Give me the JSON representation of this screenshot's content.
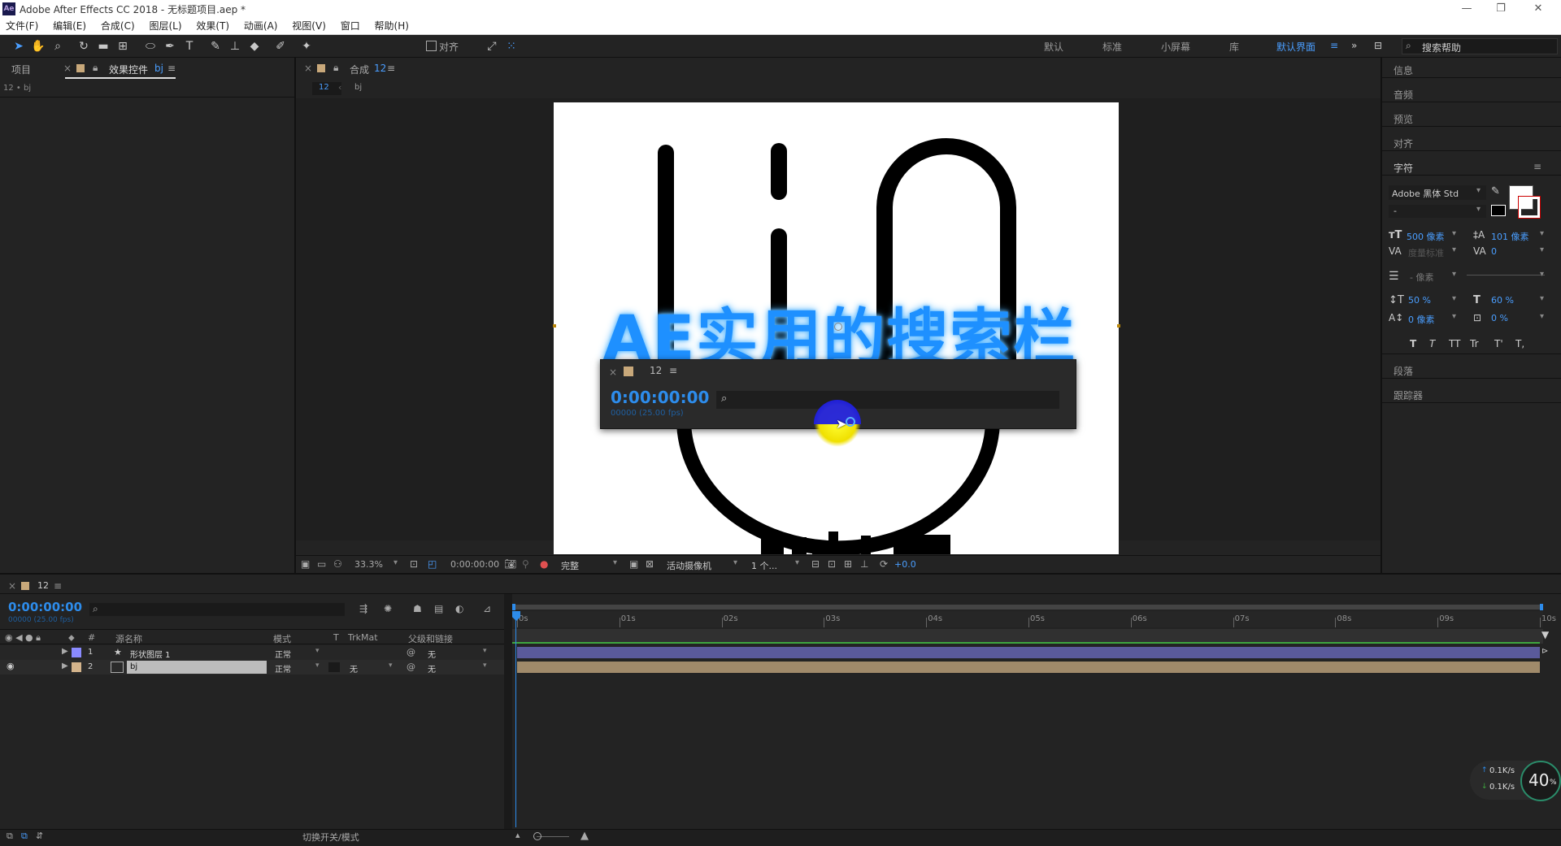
{
  "app": {
    "title": "Adobe After Effects CC 2018 - 无标题项目.aep *",
    "logo": "Ae"
  },
  "menu": [
    "文件(F)",
    "编辑(E)",
    "合成(C)",
    "图层(L)",
    "效果(T)",
    "动画(A)",
    "视图(V)",
    "窗口",
    "帮助(H)"
  ],
  "toolbar": {
    "align_label": "对齐",
    "workspaces": [
      "默认",
      "标准",
      "小屏幕",
      "库"
    ],
    "active_workspace": "默认界面",
    "search_placeholder": "搜索帮助"
  },
  "project_panel": {
    "tab_project": "项目",
    "tab_effects": "效果控件",
    "tab_effects_layer": "bj",
    "subtitle": "12 • bj"
  },
  "comp_panel": {
    "tab_label": "合成",
    "tab_comp": "12",
    "breadcrumb_comp": "12",
    "breadcrumb_layer": "bj",
    "zoom": "33.3%",
    "timecode": "0:00:00:00",
    "resolution": "完整",
    "camera": "活动摄像机",
    "views": "1 个...",
    "exposure": "+0.0"
  },
  "overlay": {
    "headline": "AE实用的搜索栏",
    "panel_comp": "12",
    "timecode": "0:00:00:00",
    "fps": "00000 (25.00 fps)"
  },
  "right_panel": {
    "items": [
      "信息",
      "音频",
      "预览",
      "对齐",
      "字符"
    ],
    "font_family": "Adobe 黑体 Std",
    "font_style": "-",
    "size": "500 像素",
    "leading": "101 像素",
    "kerning": "度量标准",
    "tracking": "0",
    "stroke_width": "- 像素",
    "vscale": "50 %",
    "hscale": "60 %",
    "baseline": "0 像素",
    "tsume": "0 %",
    "styles": [
      "T",
      "T",
      "TT",
      "Tr",
      "T'",
      "T,"
    ],
    "paragraph": "段落",
    "tracker": "跟踪器"
  },
  "timeline": {
    "comp_tab": "12",
    "timecode": "0:00:00:00",
    "fps": "00000 (25.00 fps)",
    "headers": {
      "num": "#",
      "name": "源名称",
      "mode": "模式",
      "t": "T",
      "trkmat": "TrkMat",
      "parent": "父级和链接"
    },
    "layers": [
      {
        "num": "1",
        "name": "形状图层 1",
        "mode": "正常",
        "trkmat": "",
        "parent": "无",
        "color": "#8a8aff"
      },
      {
        "num": "2",
        "name": "bj",
        "mode": "正常",
        "trkmat": "无",
        "parent": "无",
        "color": "#d4b48c"
      }
    ],
    "ruler": [
      "0s",
      "01s",
      "02s",
      "03s",
      "04s",
      "05s",
      "06s",
      "07s",
      "08s",
      "09s",
      "10s"
    ],
    "bottom_label": "切换开关/模式"
  },
  "net_widget": {
    "up": "0.1K/s",
    "down": "0.1K/s",
    "percent": "40",
    "percent_unit": "%"
  },
  "colors": {
    "accent": "#2d8ceb",
    "layer1_bar": "#5a5a9a",
    "layer2_bar": "#a08a6a",
    "headline": "#1e90ff"
  }
}
